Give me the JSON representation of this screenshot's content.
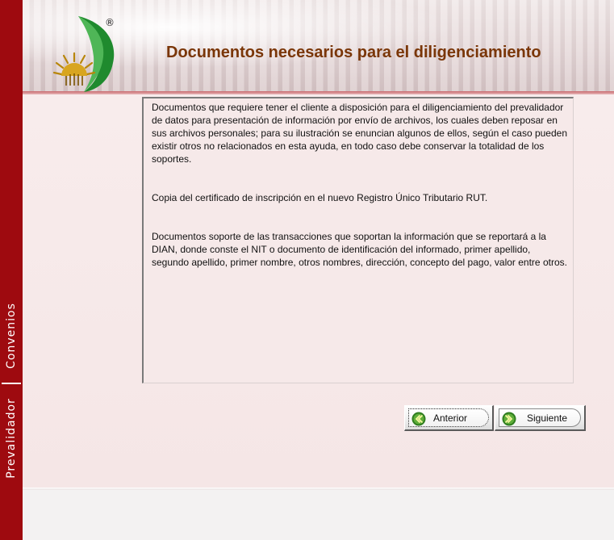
{
  "app": {
    "brand_mark": "®"
  },
  "header": {
    "title": "Documentos necesarios para el diligenciamiento"
  },
  "sidebar": {
    "labels": [
      "Convenios",
      "Prevalidador"
    ]
  },
  "content": {
    "paragraphs": [
      "Documentos que requiere tener el cliente a disposición para el diligenciamiento del prevalidador de datos para presentación de información por envío de archivos, los cuales deben reposar en sus archivos personales; para su ilustración se enuncian algunos de ellos, según el caso pueden existir otros no relacionados en esta ayuda, en todo caso debe conservar la totalidad de los soportes.",
      "Copia del certificado de inscripción en el nuevo Registro Único Tributario RUT.",
      "Documentos soporte de las transacciones que soportan la información que se reportará a la DIAN, donde conste el NIT o documento de identificación del informado, primer apellido, segundo apellido, primer nombre, otros nombres, dirección, concepto del pago, valor entre otros."
    ]
  },
  "navigation": {
    "previous_label": "Anterior",
    "next_label": "Siguiente",
    "previous_icon": "chevron-left-icon",
    "next_icon": "chevron-right-icon"
  },
  "colors": {
    "sidebar": "#9e0a0f",
    "title": "#7a3608",
    "logo_green": "#1f8a2e",
    "logo_gold": "#b8860b",
    "button_icon_green": "#2f7d1f"
  }
}
